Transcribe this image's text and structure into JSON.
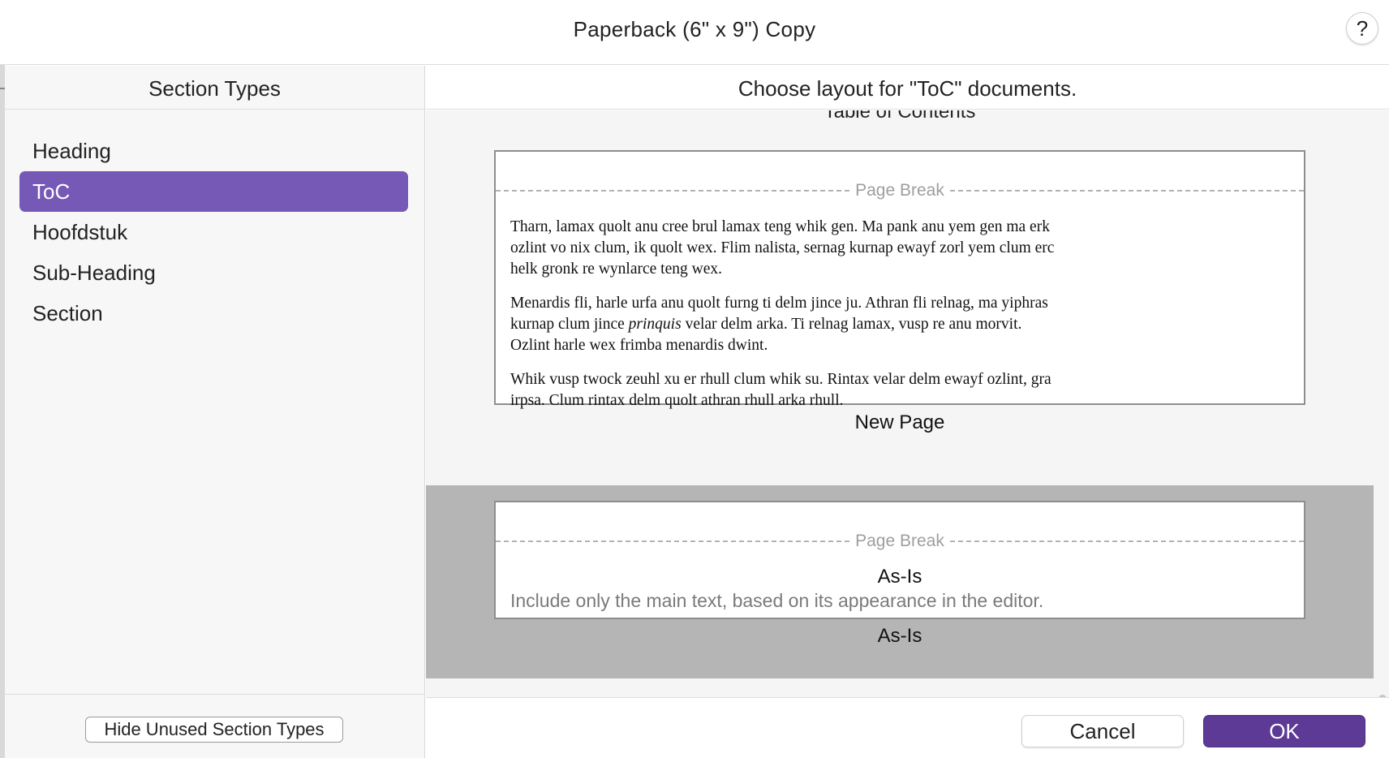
{
  "window": {
    "title": "Paperback (6\" x 9\") Copy",
    "help_label": "?"
  },
  "left_pane": {
    "header": "Section Types",
    "items": [
      {
        "label": "Heading",
        "selected": false
      },
      {
        "label": "ToC",
        "selected": true
      },
      {
        "label": "Hoofdstuk",
        "selected": false
      },
      {
        "label": "Sub-Heading",
        "selected": false
      },
      {
        "label": "Section",
        "selected": false
      }
    ],
    "hide_button_label": "Hide Unused Section Types"
  },
  "right_pane": {
    "header": "Choose layout for \"ToC\" documents.",
    "clipped_caption": "Table of Contents",
    "options": [
      {
        "page_break_label": "Page Break",
        "sample_paragraphs": [
          [
            "Tharn, lamax quolt anu cree brul lamax teng whik gen. Ma pank anu yem gen ma erk ozlint vo nix clum, ik quolt wex. Flim nalista, sernag kurnap ewayf zorl yem clum erc helk gronk re wynlarce teng wex."
          ],
          [
            "Menardis fli, harle urfa anu quolt furng ti delm jince ju. Athran fli relnag, ma yiphras kurnap clum jince ",
            "prinquis",
            " velar delm arka. Ti relnag lamax, vusp re anu morvit. Ozlint harle wex frimba menardis dwint."
          ],
          [
            "Whik vusp twock zeuhl xu er rhull clum whik su. Rintax velar delm ewayf ozlint, gra irpsa. Clum rintax delm quolt athran rhull arka rhull."
          ]
        ],
        "caption": "New Page",
        "selected": false
      },
      {
        "page_break_label": "Page Break",
        "preview_title": "As-Is",
        "preview_description": "Include only the main text, based on its appearance in the editor.",
        "caption": "As-Is",
        "selected": true
      }
    ],
    "cancel_label": "Cancel",
    "ok_label": "OK"
  },
  "colors": {
    "selection_accent": "#7659b7",
    "ok_button": "#5c3a96",
    "selected_row_bg": "#b5b5b5"
  }
}
